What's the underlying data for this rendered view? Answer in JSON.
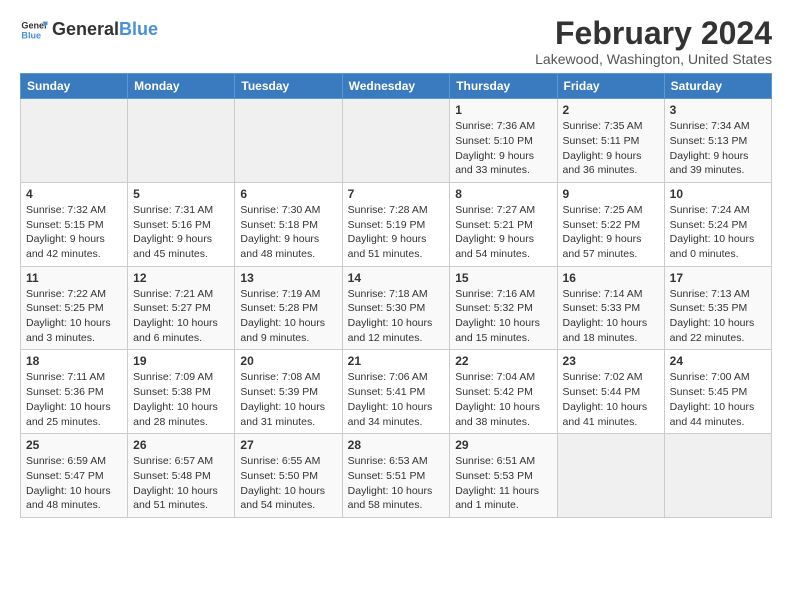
{
  "logo": {
    "text_general": "General",
    "text_blue": "Blue"
  },
  "header": {
    "title": "February 2024",
    "subtitle": "Lakewood, Washington, United States"
  },
  "weekdays": [
    "Sunday",
    "Monday",
    "Tuesday",
    "Wednesday",
    "Thursday",
    "Friday",
    "Saturday"
  ],
  "weeks": [
    [
      {
        "day": "",
        "info": ""
      },
      {
        "day": "",
        "info": ""
      },
      {
        "day": "",
        "info": ""
      },
      {
        "day": "",
        "info": ""
      },
      {
        "day": "1",
        "info": "Sunrise: 7:36 AM\nSunset: 5:10 PM\nDaylight: 9 hours\nand 33 minutes."
      },
      {
        "day": "2",
        "info": "Sunrise: 7:35 AM\nSunset: 5:11 PM\nDaylight: 9 hours\nand 36 minutes."
      },
      {
        "day": "3",
        "info": "Sunrise: 7:34 AM\nSunset: 5:13 PM\nDaylight: 9 hours\nand 39 minutes."
      }
    ],
    [
      {
        "day": "4",
        "info": "Sunrise: 7:32 AM\nSunset: 5:15 PM\nDaylight: 9 hours\nand 42 minutes."
      },
      {
        "day": "5",
        "info": "Sunrise: 7:31 AM\nSunset: 5:16 PM\nDaylight: 9 hours\nand 45 minutes."
      },
      {
        "day": "6",
        "info": "Sunrise: 7:30 AM\nSunset: 5:18 PM\nDaylight: 9 hours\nand 48 minutes."
      },
      {
        "day": "7",
        "info": "Sunrise: 7:28 AM\nSunset: 5:19 PM\nDaylight: 9 hours\nand 51 minutes."
      },
      {
        "day": "8",
        "info": "Sunrise: 7:27 AM\nSunset: 5:21 PM\nDaylight: 9 hours\nand 54 minutes."
      },
      {
        "day": "9",
        "info": "Sunrise: 7:25 AM\nSunset: 5:22 PM\nDaylight: 9 hours\nand 57 minutes."
      },
      {
        "day": "10",
        "info": "Sunrise: 7:24 AM\nSunset: 5:24 PM\nDaylight: 10 hours\nand 0 minutes."
      }
    ],
    [
      {
        "day": "11",
        "info": "Sunrise: 7:22 AM\nSunset: 5:25 PM\nDaylight: 10 hours\nand 3 minutes."
      },
      {
        "day": "12",
        "info": "Sunrise: 7:21 AM\nSunset: 5:27 PM\nDaylight: 10 hours\nand 6 minutes."
      },
      {
        "day": "13",
        "info": "Sunrise: 7:19 AM\nSunset: 5:28 PM\nDaylight: 10 hours\nand 9 minutes."
      },
      {
        "day": "14",
        "info": "Sunrise: 7:18 AM\nSunset: 5:30 PM\nDaylight: 10 hours\nand 12 minutes."
      },
      {
        "day": "15",
        "info": "Sunrise: 7:16 AM\nSunset: 5:32 PM\nDaylight: 10 hours\nand 15 minutes."
      },
      {
        "day": "16",
        "info": "Sunrise: 7:14 AM\nSunset: 5:33 PM\nDaylight: 10 hours\nand 18 minutes."
      },
      {
        "day": "17",
        "info": "Sunrise: 7:13 AM\nSunset: 5:35 PM\nDaylight: 10 hours\nand 22 minutes."
      }
    ],
    [
      {
        "day": "18",
        "info": "Sunrise: 7:11 AM\nSunset: 5:36 PM\nDaylight: 10 hours\nand 25 minutes."
      },
      {
        "day": "19",
        "info": "Sunrise: 7:09 AM\nSunset: 5:38 PM\nDaylight: 10 hours\nand 28 minutes."
      },
      {
        "day": "20",
        "info": "Sunrise: 7:08 AM\nSunset: 5:39 PM\nDaylight: 10 hours\nand 31 minutes."
      },
      {
        "day": "21",
        "info": "Sunrise: 7:06 AM\nSunset: 5:41 PM\nDaylight: 10 hours\nand 34 minutes."
      },
      {
        "day": "22",
        "info": "Sunrise: 7:04 AM\nSunset: 5:42 PM\nDaylight: 10 hours\nand 38 minutes."
      },
      {
        "day": "23",
        "info": "Sunrise: 7:02 AM\nSunset: 5:44 PM\nDaylight: 10 hours\nand 41 minutes."
      },
      {
        "day": "24",
        "info": "Sunrise: 7:00 AM\nSunset: 5:45 PM\nDaylight: 10 hours\nand 44 minutes."
      }
    ],
    [
      {
        "day": "25",
        "info": "Sunrise: 6:59 AM\nSunset: 5:47 PM\nDaylight: 10 hours\nand 48 minutes."
      },
      {
        "day": "26",
        "info": "Sunrise: 6:57 AM\nSunset: 5:48 PM\nDaylight: 10 hours\nand 51 minutes."
      },
      {
        "day": "27",
        "info": "Sunrise: 6:55 AM\nSunset: 5:50 PM\nDaylight: 10 hours\nand 54 minutes."
      },
      {
        "day": "28",
        "info": "Sunrise: 6:53 AM\nSunset: 5:51 PM\nDaylight: 10 hours\nand 58 minutes."
      },
      {
        "day": "29",
        "info": "Sunrise: 6:51 AM\nSunset: 5:53 PM\nDaylight: 11 hours\nand 1 minute."
      },
      {
        "day": "",
        "info": ""
      },
      {
        "day": "",
        "info": ""
      }
    ]
  ]
}
